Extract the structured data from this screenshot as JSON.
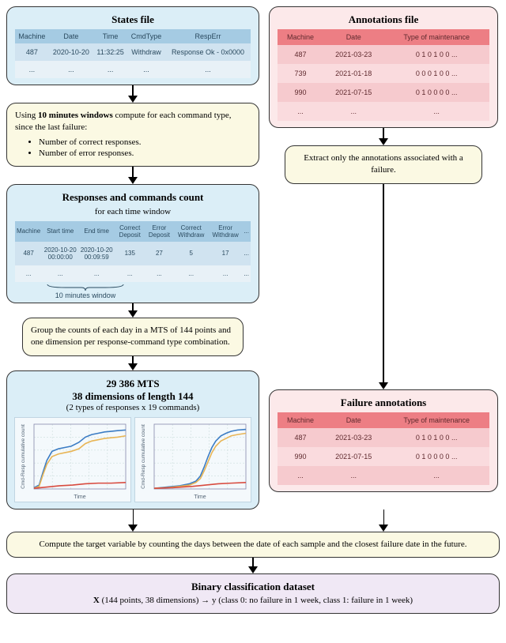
{
  "states_file": {
    "title": "States file",
    "headers": [
      "Machine",
      "Date",
      "Time",
      "CmdType",
      "RespErr"
    ],
    "rows": [
      [
        "487",
        "2020-10-20",
        "11:32:25",
        "Withdraw",
        "Response Ok - 0x0000"
      ],
      [
        "...",
        "...",
        "...",
        "...",
        "..."
      ]
    ]
  },
  "annotations_file": {
    "title": "Annotations file",
    "headers": [
      "Machine",
      "Date",
      "Type of maintenance"
    ],
    "rows": [
      [
        "487",
        "2021-03-23",
        "0 1 0 1 0 0 ..."
      ],
      [
        "739",
        "2021-01-18",
        "0 0 0 1 0 0 ..."
      ],
      [
        "990",
        "2021-07-15",
        "0 1 0 0 0 0 ..."
      ],
      [
        "...",
        "...",
        "..."
      ]
    ]
  },
  "step_windows": {
    "prefix": "Using ",
    "bold": "10 minutes windows",
    "suffix": " compute for each command type, since the last failure:",
    "bullets": [
      "Number of correct responses.",
      "Number of error responses."
    ]
  },
  "step_extract": "Extract only the annotations associated with a failure.",
  "responses_count": {
    "title": "Responses and commands count",
    "subtitle": "for each time window",
    "headers": [
      "Machine",
      "Start time",
      "End time",
      "Correct Deposit",
      "Error Deposit",
      "Correct Withdraw",
      "Error Withdraw",
      "..."
    ],
    "rows": [
      [
        "487",
        "2020-10-20 00:00:00",
        "2020-10-20 00:09:59",
        "135",
        "27",
        "5",
        "17",
        "..."
      ],
      [
        "...",
        "...",
        "...",
        "...",
        "...",
        "...",
        "...",
        "..."
      ]
    ],
    "brace_label": "10 minutes window"
  },
  "step_group": "Group the counts of each day in a MTS of 144 points and one dimension per response-command type combination.",
  "mts_box": {
    "line1": "29 386 MTS",
    "line2": "38 dimensions of length 144",
    "line3": "(2 types of responses x 19 commands)",
    "chart_ylabel": "Cmd-Resp cumulative count",
    "chart_xlabel": "Time"
  },
  "failure_annotations": {
    "title": "Failure annotations",
    "headers": [
      "Machine",
      "Date",
      "Type of maintenance"
    ],
    "rows": [
      [
        "487",
        "2021-03-23",
        "0 1 0 1 0 0 ..."
      ],
      [
        "990",
        "2021-07-15",
        "0 1 0 0 0 0 ..."
      ],
      [
        "...",
        "...",
        "..."
      ]
    ]
  },
  "step_target": "Compute the target variable by counting the days between the date of each sample and the closest failure date in the future.",
  "final_box": {
    "title": "Binary classification dataset",
    "formula_prefix_bold": "X",
    "formula_x": " (144 points, 38 dimensions) → y (class 0: no failure in 1 week, class 1: failure in 1 week)"
  },
  "chart_data": [
    {
      "type": "line",
      "xlabel": "Time",
      "ylabel": "Cmd-Resp cumulative count",
      "series": [
        {
          "name": "blue",
          "points": [
            [
              0,
              2
            ],
            [
              8,
              6
            ],
            [
              14,
              26
            ],
            [
              20,
              44
            ],
            [
              28,
              58
            ],
            [
              38,
              62
            ],
            [
              48,
              64
            ],
            [
              58,
              66
            ],
            [
              70,
              72
            ],
            [
              80,
              80
            ],
            [
              90,
              84
            ],
            [
              100,
              86
            ],
            [
              110,
              88
            ],
            [
              120,
              89
            ],
            [
              130,
              90
            ],
            [
              143,
              91
            ]
          ]
        },
        {
          "name": "orange",
          "points": [
            [
              0,
              1
            ],
            [
              8,
              4
            ],
            [
              14,
              22
            ],
            [
              20,
              38
            ],
            [
              28,
              50
            ],
            [
              38,
              54
            ],
            [
              48,
              56
            ],
            [
              58,
              58
            ],
            [
              70,
              62
            ],
            [
              80,
              70
            ],
            [
              90,
              74
            ],
            [
              100,
              76
            ],
            [
              110,
              78
            ],
            [
              120,
              79
            ],
            [
              130,
              80
            ],
            [
              143,
              82
            ]
          ]
        },
        {
          "name": "red",
          "points": [
            [
              0,
              1
            ],
            [
              20,
              3
            ],
            [
              40,
              5
            ],
            [
              60,
              6
            ],
            [
              80,
              8
            ],
            [
              100,
              9
            ],
            [
              120,
              9
            ],
            [
              143,
              10
            ]
          ]
        }
      ],
      "xlim": [
        0,
        143
      ],
      "ylim": [
        0,
        100
      ]
    },
    {
      "type": "line",
      "xlabel": "Time",
      "ylabel": "Cmd-Resp cumulative count",
      "series": [
        {
          "name": "blue",
          "points": [
            [
              0,
              1
            ],
            [
              20,
              3
            ],
            [
              40,
              5
            ],
            [
              55,
              8
            ],
            [
              65,
              12
            ],
            [
              72,
              20
            ],
            [
              78,
              34
            ],
            [
              84,
              50
            ],
            [
              90,
              64
            ],
            [
              96,
              74
            ],
            [
              104,
              82
            ],
            [
              112,
              86
            ],
            [
              120,
              89
            ],
            [
              130,
              91
            ],
            [
              143,
              92
            ]
          ]
        },
        {
          "name": "orange",
          "points": [
            [
              0,
              1
            ],
            [
              20,
              2
            ],
            [
              40,
              4
            ],
            [
              55,
              6
            ],
            [
              65,
              10
            ],
            [
              72,
              16
            ],
            [
              78,
              28
            ],
            [
              84,
              42
            ],
            [
              90,
              56
            ],
            [
              96,
              66
            ],
            [
              104,
              74
            ],
            [
              112,
              78
            ],
            [
              120,
              82
            ],
            [
              130,
              84
            ],
            [
              143,
              86
            ]
          ]
        },
        {
          "name": "red",
          "points": [
            [
              0,
              1
            ],
            [
              30,
              2
            ],
            [
              60,
              4
            ],
            [
              80,
              6
            ],
            [
              100,
              8
            ],
            [
              120,
              9
            ],
            [
              143,
              10
            ]
          ]
        }
      ],
      "xlim": [
        0,
        143
      ],
      "ylim": [
        0,
        100
      ]
    }
  ]
}
